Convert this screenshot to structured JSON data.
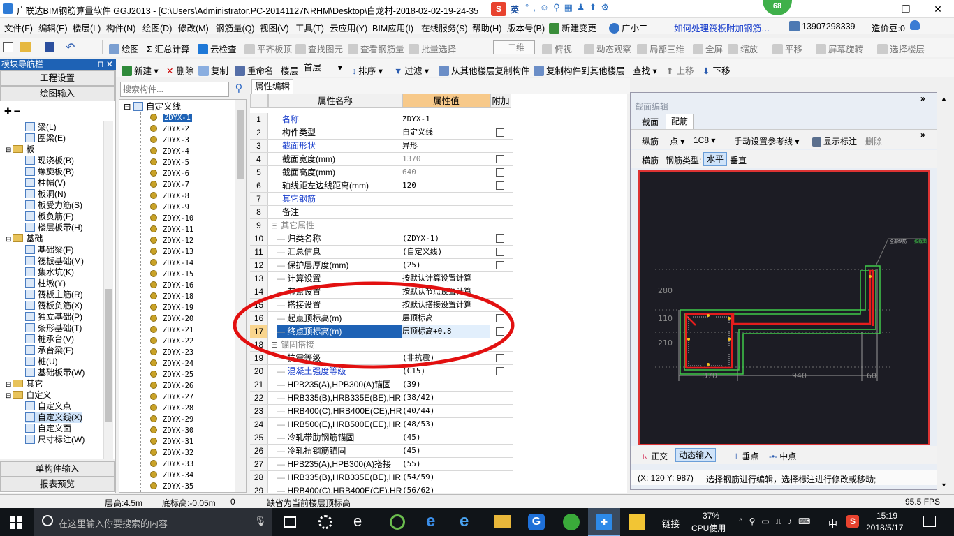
{
  "window": {
    "title": "广联达BIM钢筋算量软件 GGJ2013 - [C:\\Users\\Administrator.PC-20141127NRHM\\Desktop\\白龙村-2018-02-02-19-24-35"
  },
  "ime": {
    "lang": "英",
    "badge": "68"
  },
  "menu": [
    "文件(F)",
    "编辑(E)",
    "楼层(L)",
    "构件(N)",
    "绘图(D)",
    "修改(M)",
    "钢筋量(Q)",
    "视图(V)",
    "工具(T)",
    "云应用(Y)",
    "BIM应用(I)",
    "在线服务(S)",
    "帮助(H)",
    "版本号(B)",
    "新建变更",
    "广小二",
    "如何处理筏板附加钢筋…",
    "13907298339",
    "造价豆:0"
  ],
  "toolbar1": [
    "绘图",
    "汇总计算",
    "云检查",
    "平齐板顶",
    "查找图元",
    "查看钢筋量",
    "批量选择",
    "二维",
    "俯视",
    "动态观察",
    "局部三维",
    "全屏",
    "缩放",
    "平移",
    "屏幕旋转",
    "选择楼层"
  ],
  "toolbar2": [
    "新建",
    "删除",
    "复制",
    "重命名",
    "楼层",
    "首层",
    "排序",
    "过滤",
    "从其他楼层复制构件",
    "复制构件到其他楼层",
    "查找",
    "上移",
    "下移"
  ],
  "nav": {
    "header": "模块导航栏",
    "buttons": [
      "工程设置",
      "绘图输入"
    ],
    "bottom_buttons": [
      "单构件输入",
      "报表预览"
    ],
    "tree": [
      {
        "label": "梁(L)",
        "level": 2
      },
      {
        "label": "圈梁(E)",
        "level": 2
      },
      {
        "label": "板",
        "level": 1,
        "folder": true
      },
      {
        "label": "现浇板(B)",
        "level": 2
      },
      {
        "label": "螺旋板(B)",
        "level": 2
      },
      {
        "label": "柱帽(V)",
        "level": 2
      },
      {
        "label": "板洞(N)",
        "level": 2
      },
      {
        "label": "板受力筋(S)",
        "level": 2
      },
      {
        "label": "板负筋(F)",
        "level": 2
      },
      {
        "label": "楼层板带(H)",
        "level": 2
      },
      {
        "label": "基础",
        "level": 1,
        "folder": true
      },
      {
        "label": "基础梁(F)",
        "level": 2
      },
      {
        "label": "筏板基础(M)",
        "level": 2
      },
      {
        "label": "集水坑(K)",
        "level": 2
      },
      {
        "label": "柱墩(Y)",
        "level": 2
      },
      {
        "label": "筏板主筋(R)",
        "level": 2
      },
      {
        "label": "筏板负筋(X)",
        "level": 2
      },
      {
        "label": "独立基础(P)",
        "level": 2
      },
      {
        "label": "条形基础(T)",
        "level": 2
      },
      {
        "label": "桩承台(V)",
        "level": 2
      },
      {
        "label": "承台梁(F)",
        "level": 2
      },
      {
        "label": "桩(U)",
        "level": 2
      },
      {
        "label": "基础板带(W)",
        "level": 2
      },
      {
        "label": "其它",
        "level": 1,
        "folder": true
      },
      {
        "label": "自定义",
        "level": 1,
        "folder": true
      },
      {
        "label": "自定义点",
        "level": 2
      },
      {
        "label": "自定义线(X)",
        "level": 2,
        "selected": true
      },
      {
        "label": "自定义面",
        "level": 2
      },
      {
        "label": "尺寸标注(W)",
        "level": 2
      }
    ]
  },
  "search": {
    "placeholder": "搜索构件..."
  },
  "component_list": {
    "root": "自定义线",
    "items": [
      "ZDYX-1",
      "ZDYX-2",
      "ZDYX-3",
      "ZDYX-4",
      "ZDYX-5",
      "ZDYX-6",
      "ZDYX-7",
      "ZDYX-8",
      "ZDYX-9",
      "ZDYX-10",
      "ZDYX-11",
      "ZDYX-12",
      "ZDYX-13",
      "ZDYX-14",
      "ZDYX-15",
      "ZDYX-16",
      "ZDYX-18",
      "ZDYX-19",
      "ZDYX-20",
      "ZDYX-21",
      "ZDYX-22",
      "ZDYX-23",
      "ZDYX-24",
      "ZDYX-25",
      "ZDYX-26",
      "ZDYX-27",
      "ZDYX-28",
      "ZDYX-29",
      "ZDYX-30",
      "ZDYX-31",
      "ZDYX-32",
      "ZDYX-33",
      "ZDYX-34",
      "ZDYX-35"
    ]
  },
  "props": {
    "tab": "属性编辑",
    "col_name": "属性名称",
    "col_value": "属性值",
    "col_extra": "附加",
    "rows": [
      {
        "n": "1",
        "name": "名称",
        "value": "ZDYX-1",
        "blue": true
      },
      {
        "n": "2",
        "name": "构件类型",
        "value": "自定义线",
        "cb": true
      },
      {
        "n": "3",
        "name": "截面形状",
        "value": "异形",
        "blue": true
      },
      {
        "n": "4",
        "name": "截面宽度(mm)",
        "value": "1370",
        "gray": true,
        "cb": true
      },
      {
        "n": "5",
        "name": "截面高度(mm)",
        "value": "640",
        "gray": true,
        "cb": true
      },
      {
        "n": "6",
        "name": "轴线距左边线距离(mm)",
        "value": "120",
        "cb": true
      },
      {
        "n": "7",
        "name": "其它钢筋",
        "value": "",
        "blue": true
      },
      {
        "n": "8",
        "name": "备注",
        "value": ""
      },
      {
        "n": "9",
        "name": "其它属性",
        "value": "",
        "group": true
      },
      {
        "n": "10",
        "name": "归类名称",
        "value": "(ZDYX-1)",
        "cb": true,
        "indent": true
      },
      {
        "n": "11",
        "name": "汇总信息",
        "value": "(自定义线)",
        "cb": true,
        "indent": true
      },
      {
        "n": "12",
        "name": "保护层厚度(mm)",
        "value": "(25)",
        "cb": true,
        "indent": true
      },
      {
        "n": "13",
        "name": "计算设置",
        "value": "按默认计算设置计算",
        "indent": true
      },
      {
        "n": "14",
        "name": "节点设置",
        "value": "按默认节点设置计算",
        "indent": true
      },
      {
        "n": "15",
        "name": "搭接设置",
        "value": "按默认搭接设置计算",
        "indent": true
      },
      {
        "n": "16",
        "name": "起点顶标高(m)",
        "value": "层顶标高",
        "cb": true,
        "indent": true
      },
      {
        "n": "17",
        "name": "终点顶标高(m)",
        "value": "层顶标高+0.8",
        "cb": true,
        "indent": true,
        "selected": true
      },
      {
        "n": "18",
        "name": "锚固搭接",
        "value": "",
        "group": true
      },
      {
        "n": "19",
        "name": "抗震等级",
        "value": "(非抗震)",
        "cb": true,
        "indent": true
      },
      {
        "n": "20",
        "name": "混凝土强度等级",
        "value": "(C15)",
        "cb": true,
        "indent": true,
        "blue": true
      },
      {
        "n": "21",
        "name": "HPB235(A),HPB300(A)锚固",
        "value": "(39)",
        "indent": true
      },
      {
        "n": "22",
        "name": "HRB335(B),HRB335E(BE),HRBF",
        "value": "(38/42)",
        "indent": true
      },
      {
        "n": "23",
        "name": "HRB400(C),HRB400E(CE),HRBF",
        "value": "(40/44)",
        "indent": true
      },
      {
        "n": "24",
        "name": "HRB500(E),HRB500E(EE),HRBF",
        "value": "(48/53)",
        "indent": true
      },
      {
        "n": "25",
        "name": "冷轧带肋钢筋锚固",
        "value": "(45)",
        "indent": true
      },
      {
        "n": "26",
        "name": "冷轧扭钢筋锚固",
        "value": "(45)",
        "indent": true
      },
      {
        "n": "27",
        "name": "HPB235(A),HPB300(A)搭接",
        "value": "(55)",
        "indent": true
      },
      {
        "n": "28",
        "name": "HRB335(B),HRB335E(BE),HRBF",
        "value": "(54/59)",
        "indent": true
      },
      {
        "n": "29",
        "name": "HRB400(C),HRB400E(CE),HRBF",
        "value": "(56/62)",
        "indent": true
      }
    ]
  },
  "section_editor": {
    "title": "截面编辑",
    "tabs": [
      "截面",
      "配筋"
    ],
    "toolbar": [
      "纵筋",
      "点",
      "1C8",
      "手动设置参考线",
      "显示标注",
      "删除"
    ],
    "row2": [
      "横筋",
      "钢筋类型:",
      "水平",
      "垂直"
    ],
    "dims_left": [
      "280",
      "110",
      "210"
    ],
    "dims_bottom": [
      "370",
      "940",
      "60"
    ],
    "bottom_tools": [
      "正交",
      "动态输入",
      "垂点",
      "中点"
    ],
    "coord": "(X: 120 Y: 987)",
    "hint": "选择钢筋进行编辑，选择标注进行修改或移动;"
  },
  "status": {
    "floor_height": "层高:4.5m",
    "bottom_elev": "底标高:-0.05m",
    "zero": "0",
    "message": "缺省为当前楼层顶标高",
    "fps": "95.5 FPS"
  },
  "taskbar": {
    "search": "在这里输入你要搜索的内容",
    "link": "链接",
    "cpu": "37%",
    "cpu_label": "CPU使用",
    "time": "15:19",
    "date": "2018/5/17",
    "lang": "中"
  }
}
